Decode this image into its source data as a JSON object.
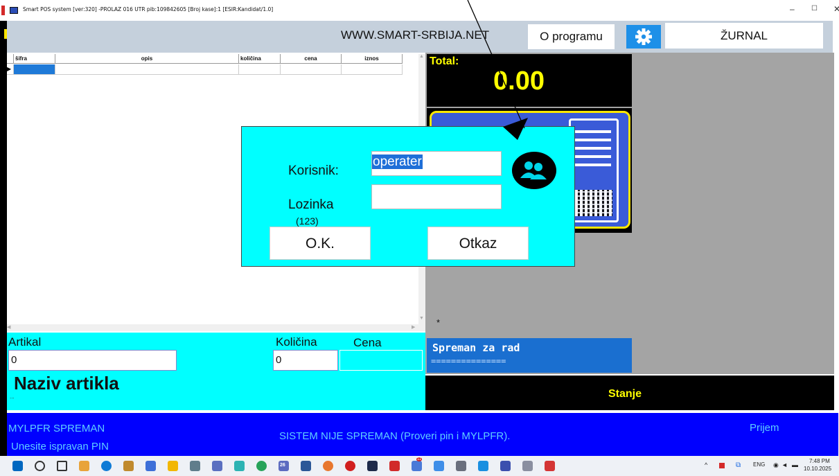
{
  "window": {
    "title": "Smart POS system   [ver:320] -PROLAZ 016 UTR  pib:109842605     [Broj kase]:1     [ESIR:Kandidat/1.0]",
    "minimize": "–",
    "maximize": "☐",
    "close": "✕"
  },
  "header": {
    "website": "WWW.SMART-SRBIJA.NET",
    "about_label": "O programu",
    "journal_label": "ŽURNAL"
  },
  "grid": {
    "columns": [
      "šifra",
      "opis",
      "količina",
      "cena",
      "iznos"
    ]
  },
  "entry": {
    "artikal_label": "Artikal",
    "artikal_value": "0",
    "kolicina_label": "Količina",
    "kolicina_value": "0",
    "cena_label": "Cena",
    "cena_value": "",
    "naziv_label": "Naziv artikla",
    "naziv_sub": "..."
  },
  "totals": {
    "label": "Total:",
    "value": "0.00"
  },
  "status_panel": {
    "star": "*",
    "ready_title": "Spreman za rad",
    "ready_line": "===============",
    "stanje": "Stanje"
  },
  "statusbar": {
    "left_line1": "MYLPFR SPREMAN",
    "left_line2": "Unesite ispravan PIN",
    "center": "SISTEM NIJE SPREMAN (Proveri pin i MYLPFR).",
    "right": "Prijem"
  },
  "login": {
    "user_label": "Korisnik:",
    "user_value": "operater",
    "password_label": "Lozinka",
    "password_hint": "(123)",
    "password_value": "",
    "ok_label": "O.K.",
    "cancel_label": "Otkaz"
  },
  "taskbar": {
    "lang": "ENG",
    "time": "7:48 PM",
    "date": "10.10.2025",
    "calendar_badge": "26",
    "notif_badge": "11",
    "taskbar_colors": [
      "#0067c0",
      "#333333",
      "#333333",
      "#e8a33a",
      "#0f7bd6",
      "#c08a2e",
      "#3d6fd8",
      "#f2b705",
      "#607d8b",
      "#5a6fc0",
      "#2db3b3",
      "#27a35a",
      "#5c6bc0",
      "#2b5797",
      "#e8772e",
      "#d11f1f",
      "#1e2a4a",
      "#d12a2a",
      "#4a7ad8",
      "#3f8ee8",
      "#6a6f7d",
      "#1a8fe0",
      "#3b4fae",
      "#8a8fa0",
      "#d43535"
    ]
  },
  "colors": {
    "accent_cyan": "#00ffff",
    "total_yellow": "#ffff00",
    "status_blue": "#0000ff",
    "status_text": "#5fcfff",
    "gear_blue": "#1e90e8"
  }
}
